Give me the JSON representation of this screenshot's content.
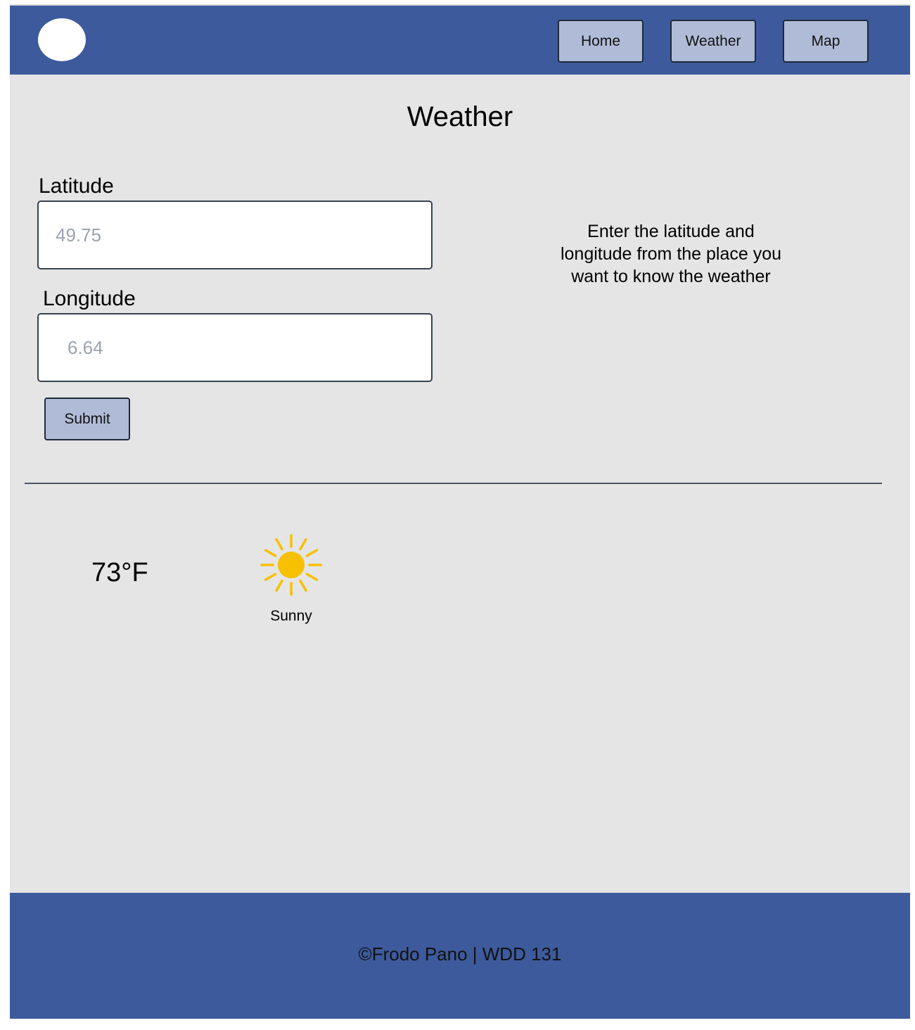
{
  "header": {
    "nav": {
      "home_label": "Home",
      "weather_label": "Weather",
      "map_label": "Map"
    }
  },
  "main": {
    "title": "Weather",
    "latitude": {
      "label": "Latitude",
      "placeholder": "49.75"
    },
    "longitude": {
      "label": "Longitude",
      "placeholder": "6.64"
    },
    "submit_label": "Submit",
    "instructions": "Enter the latitude and longitude from the place you want to know the weather"
  },
  "forecast": {
    "temperature": "73°F",
    "condition": "Sunny",
    "icon": "sun-icon"
  },
  "footer": {
    "text": "©Frodo Pano | WDD 131"
  },
  "colors": {
    "header_bg": "#3d5a9c",
    "page_bg": "#e5e5e5",
    "button_bg": "#b0bcd7",
    "sun": "#f7c000"
  }
}
